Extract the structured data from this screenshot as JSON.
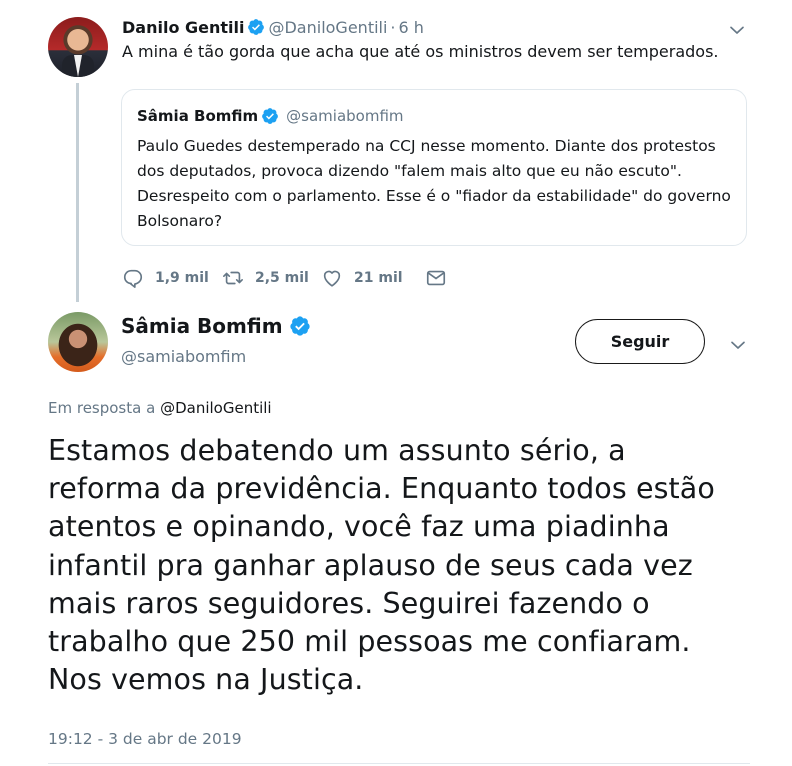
{
  "quoted_reply_tweet": {
    "author_name": "Danilo Gentili",
    "author_handle": "@DaniloGentili",
    "separator": "·",
    "time_ago": "6 h",
    "text": "A mina é tão gorda que acha que até os ministros devem ser temperados.",
    "quote": {
      "author_name": "Sâmia Bomfim",
      "author_handle": "@samiabomfim",
      "text": "Paulo Guedes destemperado na CCJ nesse momento. Diante dos protestos dos deputados, provoca dizendo \"falem mais alto que eu não escuto\". Desrespeito com o parlamento. Esse é o \"fiador da estabilidade\" do governo Bolsonaro?"
    },
    "actions": {
      "replies": "1,9 mil",
      "retweets": "2,5 mil",
      "likes": "21 mil"
    }
  },
  "main_tweet": {
    "author_name": "Sâmia Bomfim",
    "author_handle": "@samiabomfim",
    "follow_label": "Seguir",
    "reply_prefix": "Em resposta a",
    "reply_mention": "@DaniloGentili",
    "text": "Estamos debatendo um assunto sério, a reforma da previdência. Enquanto todos estão atentos e opinando, você faz uma piadinha infantil pra ganhar aplauso de seus cada vez mais raros seguidores. Seguirei fazendo o trabalho que 250 mil pessoas me confiaram. Nos vemos na Justiça.",
    "timestamp": "19:12 - 3 de abr de 2019"
  },
  "icons": {
    "verified": "verified-badge-icon",
    "chevron": "chevron-down-icon",
    "reply": "reply-icon",
    "retweet": "retweet-icon",
    "like": "heart-icon",
    "dm": "envelope-icon"
  },
  "colors": {
    "verified_blue": "#1da1f2",
    "secondary_text": "#657786",
    "primary_text": "#14171a",
    "border": "#e1e8ed"
  }
}
